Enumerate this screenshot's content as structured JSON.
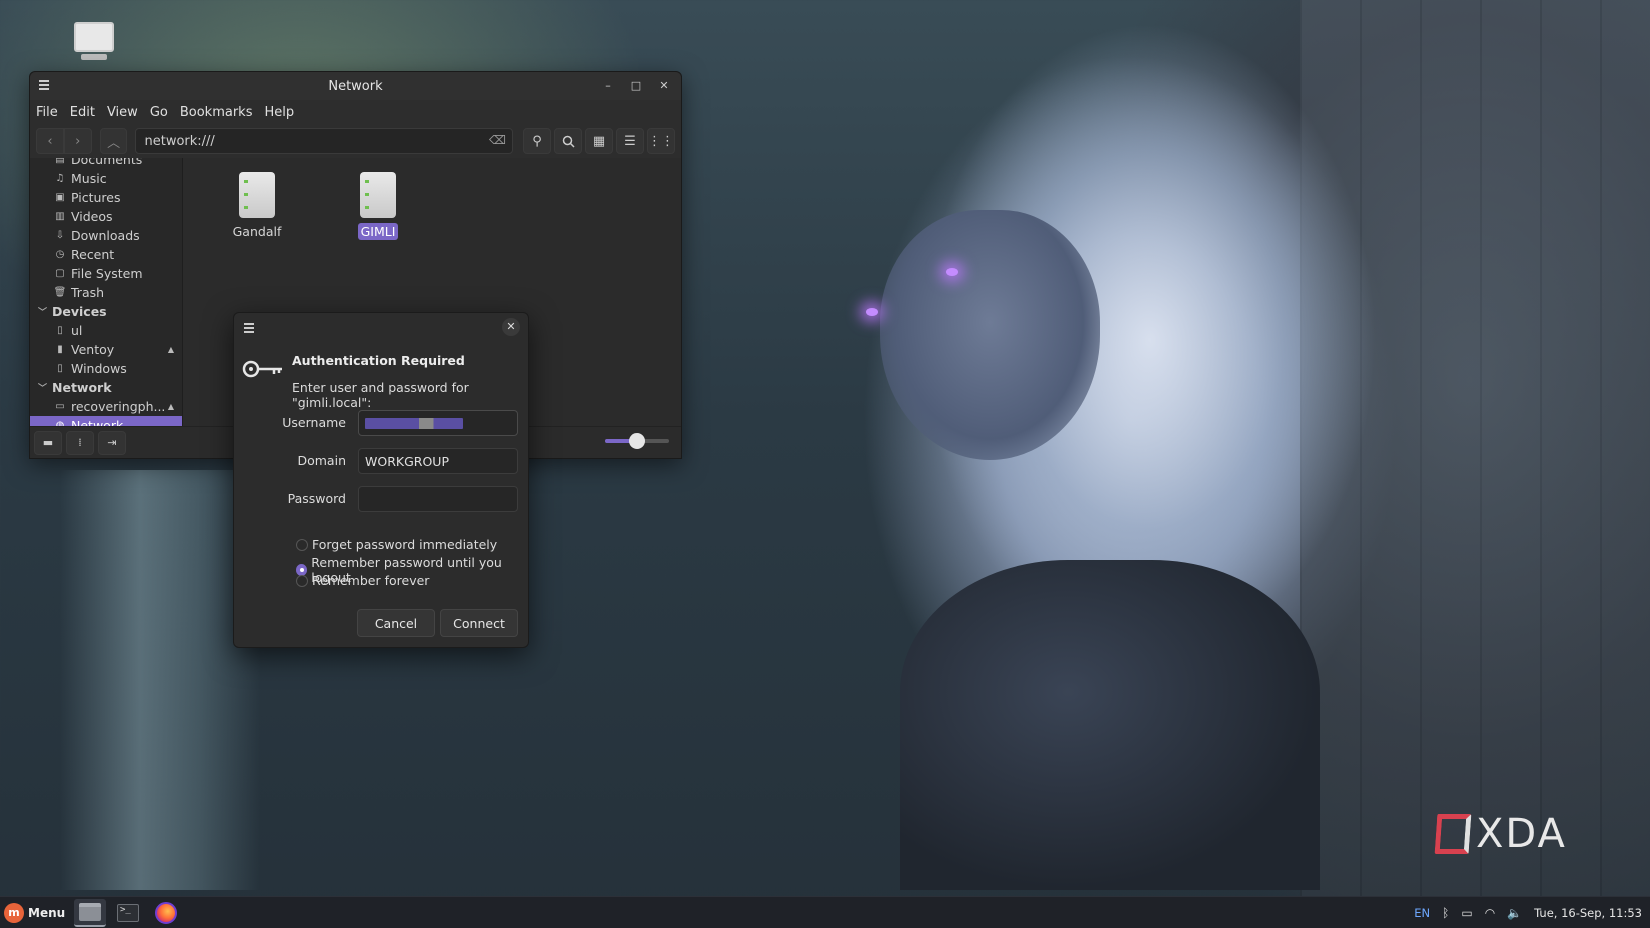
{
  "desktop": {
    "icon_label": "Computer"
  },
  "file_manager": {
    "title": "Network",
    "menu": [
      "File",
      "Edit",
      "View",
      "Go",
      "Bookmarks",
      "Help"
    ],
    "location": "network:///",
    "sidebar": {
      "places": [
        {
          "label": "Documents",
          "icon": "document-icon"
        },
        {
          "label": "Music",
          "icon": "music-icon"
        },
        {
          "label": "Pictures",
          "icon": "pictures-icon"
        },
        {
          "label": "Videos",
          "icon": "video-icon"
        },
        {
          "label": "Downloads",
          "icon": "download-icon"
        },
        {
          "label": "Recent",
          "icon": "recent-icon"
        },
        {
          "label": "File System",
          "icon": "filesystem-icon"
        },
        {
          "label": "Trash",
          "icon": "trash-icon"
        }
      ],
      "devices_header": "Devices",
      "devices": [
        {
          "label": "ul",
          "icon": "drive-icon"
        },
        {
          "label": "Ventoy",
          "icon": "usb-icon"
        },
        {
          "label": "Windows",
          "icon": "drive-icon"
        }
      ],
      "network_header": "Network",
      "network": [
        {
          "label": "recoveringph...",
          "icon": "folder-icon"
        },
        {
          "label": "Network",
          "icon": "network-icon"
        }
      ]
    },
    "servers": [
      {
        "label": "Gandalf"
      },
      {
        "label": "GIMLI"
      }
    ],
    "zoom_level": 0.5
  },
  "auth_dialog": {
    "title": "Authentication Required",
    "message": "Enter user and password for \"gimli.local\":",
    "username_label": "Username",
    "domain_label": "Domain",
    "domain_value": "WORKGROUP",
    "password_label": "Password",
    "options": [
      {
        "label": "Forget password immediately",
        "selected": false
      },
      {
        "label": "Remember password until you logout",
        "selected": true
      },
      {
        "label": "Remember forever",
        "selected": false
      }
    ],
    "cancel_label": "Cancel",
    "connect_label": "Connect"
  },
  "taskbar": {
    "menu_label": "Menu",
    "keyboard_layout": "EN",
    "clock": "Tue, 16-Sep, 11:53"
  },
  "watermark": {
    "text": "XDA"
  },
  "colors": {
    "accent": "#7b67c7",
    "window_bg": "#2b2b2b"
  }
}
